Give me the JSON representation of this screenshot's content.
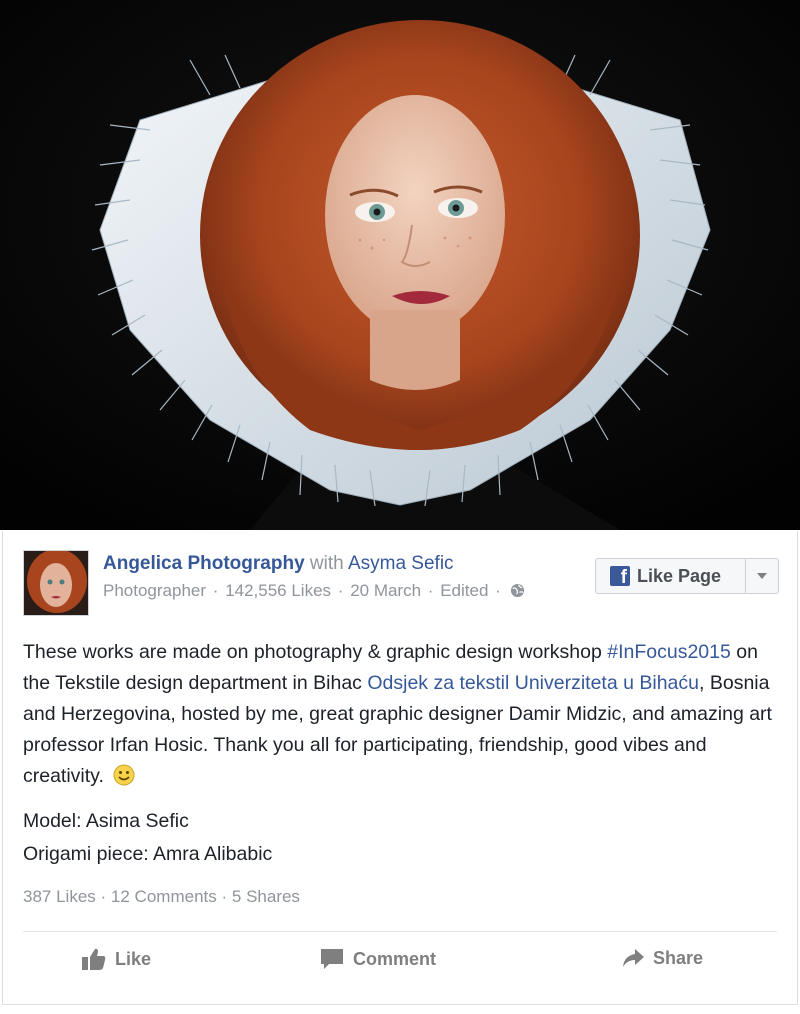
{
  "post": {
    "page_name": "Angelica Photography",
    "with_word": "with",
    "tagged_name": "Asyma Sefic",
    "category": "Photographer",
    "likes_count": "142,556 Likes",
    "date": "20 March",
    "edited": "Edited",
    "separator": "·",
    "like_page_button": "Like Page",
    "text_part1": "These works are made on photography & graphic design workshop ",
    "hashtag": "#InFocus2015",
    "text_part2": " on the Tekstile design department in Bihac ",
    "linked_entity": "Odsjek za tekstil Univerziteta u Bihaću",
    "text_part3": ", Bosnia and Herzegovina, hosted by me, great graphic designer Damir Midzic, and amazing art professor Irfan Hosic. Thank you all for participating, friendship, good vibes and creativity.",
    "model_line": "Model: Asima Sefic",
    "origami_line": "Origami piece: Amra Alibabic"
  },
  "stats": {
    "likes": "387 Likes",
    "comments": "12 Comments",
    "shares": "5 Shares",
    "separator": "·"
  },
  "actions": {
    "like": "Like",
    "comment": "Comment",
    "share": "Share"
  },
  "icons": {
    "globe": "globe-icon",
    "smile": "smile-emoji-icon",
    "facebook": "facebook-f-icon",
    "dropdown": "chevron-down-icon",
    "like": "thumbs-up-icon",
    "comment": "comment-bubble-icon",
    "share": "share-arrow-icon"
  },
  "colors": {
    "link": "#365899",
    "meta": "#90949c",
    "text": "#1d2129",
    "facebook_blue": "#3b5998",
    "action": "#7f7f7f"
  }
}
